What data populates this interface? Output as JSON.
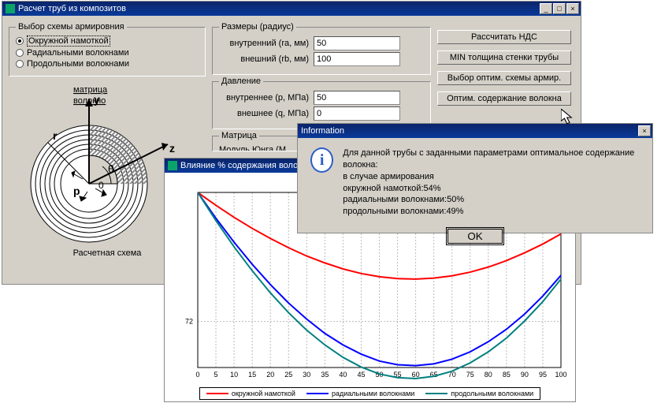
{
  "main_window": {
    "title": "Расчет труб из композитов",
    "minimize": "_",
    "maximize": "□",
    "close": "×",
    "reinforce_group": "Выбор схемы армировния",
    "reinforce_options": [
      "Окружной намоткой",
      "Радиальными волокнами",
      "Продольными волокнами"
    ],
    "scheme_caption": "Расчетная схема",
    "labels": {
      "matrix": "матрица",
      "fiber": "волокно"
    },
    "sizes_group": "Размеры (радиус)",
    "ra_lbl": "внутренний (ra, мм)",
    "ra_val": "50",
    "rb_lbl": "внешний (rb, мм)",
    "rb_val": "100",
    "pressure_group": "Давление",
    "p_lbl": "внутреннее (p, МПа)",
    "p_val": "50",
    "q_lbl": "внешнее (q, МПа)",
    "q_val": "0",
    "matrix_group": "Матрица",
    "young_lbl": "Модуль Юнга (М",
    "btns": {
      "calc": "Расcчитать НДС",
      "min": "MIN толщина стенки трубы",
      "scheme": "Выбор оптим. схемы армир.",
      "fiber": "Оптим. содержание волокна"
    }
  },
  "chart_window": {
    "title": "Влияние % содержания волокна на ра",
    "caption": "Влияние % содержания волокна на ра",
    "legend": [
      "окружной намоткой",
      "радиальными волокнами",
      "продольными волокнами"
    ]
  },
  "info_dialog": {
    "title": "Information",
    "close": "×",
    "text": "Для данной трубы с заданными параметрами оптимальное содержание волокна:\n в случае армирования\n          окружной намоткой:54%\n          радиальными волокнами:50%\n          продольными волокнами:49%",
    "ok": "OK"
  },
  "chart_data": {
    "type": "line",
    "title": "Влияние % содержания волокна на ра",
    "xlabel": "",
    "ylabel": "",
    "xlim": [
      0,
      100
    ],
    "ylim": [
      62,
      100
    ],
    "xticks": [
      0,
      5,
      10,
      15,
      20,
      25,
      30,
      35,
      40,
      45,
      50,
      55,
      60,
      65,
      70,
      75,
      80,
      85,
      90,
      95,
      100
    ],
    "yticks": [
      72
    ],
    "series": [
      {
        "name": "окружной намоткой",
        "color": "#ff0000",
        "y": [
          100,
          97.2,
          94.6,
          92.2,
          90.0,
          88.0,
          86.2,
          84.7,
          83.4,
          82.4,
          81.7,
          81.3,
          81.2,
          81.4,
          81.9,
          82.7,
          83.8,
          85.2,
          86.9,
          88.8,
          91.0
        ]
      },
      {
        "name": "радиальными волокнами",
        "color": "#0000ff",
        "y": [
          100,
          94.4,
          89.2,
          84.4,
          80.0,
          76.0,
          72.5,
          69.4,
          66.9,
          64.9,
          63.4,
          62.6,
          62.4,
          62.8,
          63.8,
          65.4,
          67.6,
          70.3,
          73.6,
          77.5,
          82.0
        ]
      },
      {
        "name": "продольными волокнами",
        "color": "#008080",
        "y": [
          100,
          93.9,
          88.2,
          83.0,
          78.2,
          73.9,
          70.1,
          66.9,
          64.2,
          62.1,
          60.6,
          59.8,
          59.6,
          60.1,
          61.2,
          63.0,
          65.4,
          68.4,
          72.1,
          76.3,
          81.2
        ]
      }
    ]
  }
}
